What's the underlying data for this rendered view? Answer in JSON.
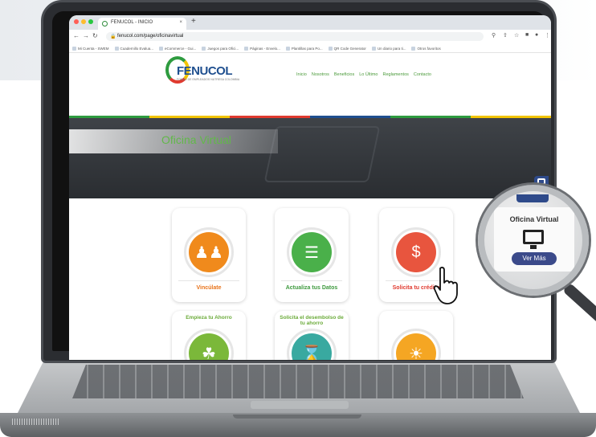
{
  "browser": {
    "tab_title": "FENUCOL - INICIO",
    "tab_close": "×",
    "new_tab": "+",
    "url": "fenucol.com/page/oficinavirtual",
    "nav_back": "←",
    "nav_forward": "→",
    "nav_reload": "↻"
  },
  "bookmarks": [
    "Mi Cuenta - SWEM",
    "Cuadernillo Evalua...",
    "eCommerce - Gui...",
    "Juegos para Ofici...",
    "Páginas - Envelo...",
    "Plantillas para Po...",
    "QR Code Generator",
    "Un diario para ti...",
    "Otros favoritos"
  ],
  "site": {
    "logo_text": "FENUCOL",
    "logo_sub": "FONDO DE EMPLEADOS NUTRESA COLOMBIA",
    "menu": [
      "Inicio",
      "Nosotros",
      "Beneficios",
      "Lo Último",
      "Reglamentos",
      "Contacto"
    ],
    "hero_title": "Oficina Virtual",
    "stripe_colors": [
      "#2e9b3f",
      "#f2c400",
      "#e03a2f",
      "#1f4f8f",
      "#2e9b3f",
      "#f2c400"
    ]
  },
  "cards": [
    {
      "label": "Vincúlate",
      "color": "#f08a1c",
      "label_color": "#e8731a",
      "icon": "people-icon"
    },
    {
      "label": "Actualiza tus Datos",
      "color": "#4ab04a",
      "label_color": "#3f9a3f",
      "icon": "clipboard-icon"
    },
    {
      "label": "Solicita tu crédito",
      "color": "#e8553e",
      "label_color": "#e03a2f",
      "icon": "money-icon"
    }
  ],
  "cards_row2": [
    {
      "label_top": "Empieza tu Ahorro",
      "color": "#7bb83a",
      "icon": "plant-icon"
    },
    {
      "label_top": "Solicita el desembolso de tu ahorro",
      "color": "#39a9a0",
      "icon": "hourglass-icon"
    },
    {
      "label_top": "",
      "color": "#f5a623",
      "icon": "sun-icon"
    }
  ],
  "magnifier": {
    "title": "Oficina Virtual",
    "button": "Ver Más"
  }
}
